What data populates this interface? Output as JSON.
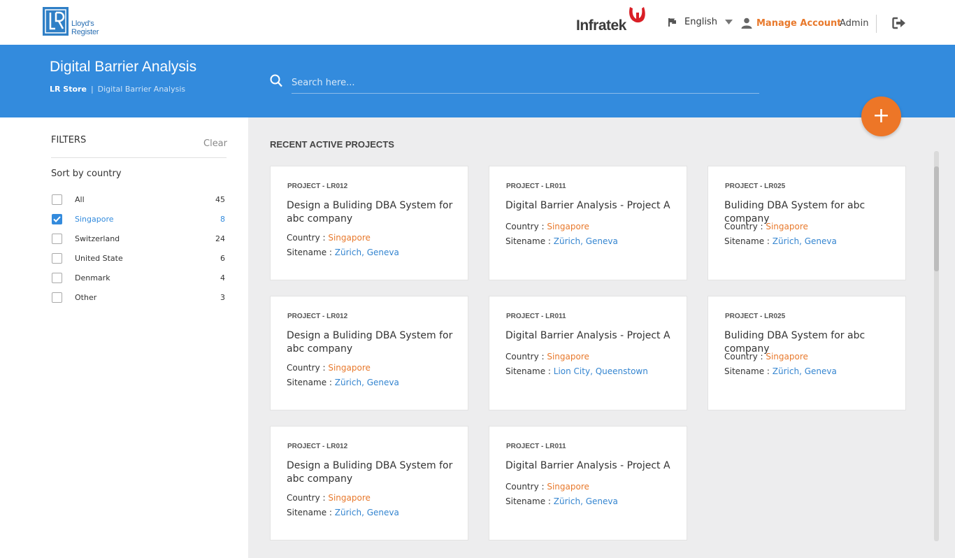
{
  "brand": {
    "lr_line1": "Lloyd's",
    "lr_line2": "Register",
    "partner": "Infratek"
  },
  "topnav": {
    "language": "English",
    "manage_account": "Manage Account",
    "admin": "Admin"
  },
  "header": {
    "title": "Digital Barrier Analysis",
    "breadcrumb": [
      "LR Store",
      "Digital Barrier Analysis"
    ],
    "breadcrumb_sep": "|",
    "search_placeholder": "Search here...",
    "fab_label": "+"
  },
  "filters": {
    "title": "FILTERS",
    "clear": "Clear",
    "sort_label": "Sort by country",
    "items": [
      {
        "label": "All",
        "count": "45",
        "checked": false
      },
      {
        "label": "Singapore",
        "count": "8",
        "checked": true
      },
      {
        "label": "Switzerland",
        "count": "24",
        "checked": false
      },
      {
        "label": "United State",
        "count": "6",
        "checked": false
      },
      {
        "label": "Denmark",
        "count": "4",
        "checked": false
      },
      {
        "label": "Other",
        "count": "3",
        "checked": false
      }
    ]
  },
  "main": {
    "section_title": "RECENT ACTIVE PROJECTS",
    "country_key": "Country :",
    "site_key": "Sitename :",
    "cards": [
      {
        "id": "PROJECT - LR012",
        "title": "Design a Buliding DBA System for abc company",
        "country": "Singapore",
        "site": "Zürich, Geneva"
      },
      {
        "id": "PROJECT - LR011",
        "title": "Digital Barrier Analysis - Project A",
        "country": "Singapore",
        "site": "Zürich, Geneva"
      },
      {
        "id": "PROJECT - LR025",
        "title": "Buliding DBA System for abc company",
        "country": "Singapore",
        "site": "Zürich, Geneva"
      },
      {
        "id": "PROJECT - LR012",
        "title": "Design a Buliding DBA System for abc company",
        "country": "Singapore",
        "site": "Zürich, Geneva"
      },
      {
        "id": "PROJECT - LR011",
        "title": "Digital Barrier Analysis - Project A",
        "country": "Singapore",
        "site": "Lion City, Queenstown"
      },
      {
        "id": "PROJECT - LR025",
        "title": "Buliding DBA System for abc company",
        "country": "Singapore",
        "site": "Zürich, Geneva"
      },
      {
        "id": "PROJECT - LR012",
        "title": "Design a Buliding DBA System for abc company",
        "country": "Singapore",
        "site": "Zürich, Geneva"
      },
      {
        "id": "PROJECT - LR011",
        "title": "Digital Barrier Analysis - Project A",
        "country": "Singapore",
        "site": "Zürich, Geneva"
      }
    ]
  },
  "colors": {
    "primary_blue": "#338bdd",
    "accent_orange": "#ed7627"
  }
}
